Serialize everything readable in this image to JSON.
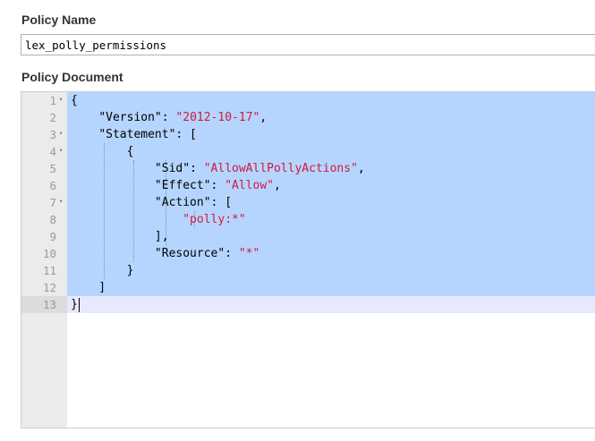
{
  "policy_name": {
    "label": "Policy Name",
    "value": "lex_polly_permissions"
  },
  "policy_document": {
    "label": "Policy Document",
    "lines": [
      {
        "num": "1",
        "fold": true,
        "parts": [
          {
            "t": "p",
            "v": "{"
          }
        ]
      },
      {
        "num": "2",
        "fold": false,
        "parts": [
          {
            "t": "p",
            "v": "    "
          },
          {
            "t": "k",
            "v": "\"Version\""
          },
          {
            "t": "p",
            "v": ": "
          },
          {
            "t": "s",
            "v": "\"2012-10-17\""
          },
          {
            "t": "p",
            "v": ","
          }
        ]
      },
      {
        "num": "3",
        "fold": true,
        "parts": [
          {
            "t": "p",
            "v": "    "
          },
          {
            "t": "k",
            "v": "\"Statement\""
          },
          {
            "t": "p",
            "v": ": ["
          }
        ]
      },
      {
        "num": "4",
        "fold": true,
        "parts": [
          {
            "t": "p",
            "v": "        {"
          }
        ]
      },
      {
        "num": "5",
        "fold": false,
        "parts": [
          {
            "t": "p",
            "v": "            "
          },
          {
            "t": "k",
            "v": "\"Sid\""
          },
          {
            "t": "p",
            "v": ": "
          },
          {
            "t": "s",
            "v": "\"AllowAllPollyActions\""
          },
          {
            "t": "p",
            "v": ","
          }
        ]
      },
      {
        "num": "6",
        "fold": false,
        "parts": [
          {
            "t": "p",
            "v": "            "
          },
          {
            "t": "k",
            "v": "\"Effect\""
          },
          {
            "t": "p",
            "v": ": "
          },
          {
            "t": "s",
            "v": "\"Allow\""
          },
          {
            "t": "p",
            "v": ","
          }
        ]
      },
      {
        "num": "7",
        "fold": true,
        "parts": [
          {
            "t": "p",
            "v": "            "
          },
          {
            "t": "k",
            "v": "\"Action\""
          },
          {
            "t": "p",
            "v": ": ["
          }
        ]
      },
      {
        "num": "8",
        "fold": false,
        "parts": [
          {
            "t": "p",
            "v": "                "
          },
          {
            "t": "s",
            "v": "\"polly:*\""
          }
        ]
      },
      {
        "num": "9",
        "fold": false,
        "parts": [
          {
            "t": "p",
            "v": "            ],"
          }
        ]
      },
      {
        "num": "10",
        "fold": false,
        "parts": [
          {
            "t": "p",
            "v": "            "
          },
          {
            "t": "k",
            "v": "\"Resource\""
          },
          {
            "t": "p",
            "v": ": "
          },
          {
            "t": "s",
            "v": "\"*\""
          }
        ]
      },
      {
        "num": "11",
        "fold": false,
        "parts": [
          {
            "t": "p",
            "v": "        }"
          }
        ]
      },
      {
        "num": "12",
        "fold": false,
        "parts": [
          {
            "t": "p",
            "v": "    ]"
          }
        ]
      },
      {
        "num": "13",
        "fold": false,
        "parts": [
          {
            "t": "p",
            "v": "}"
          }
        ]
      }
    ],
    "active_line": 13,
    "selected_lines": 12
  },
  "colors": {
    "selection": "#b5d5ff",
    "string": "#d01a3c",
    "gutter": "#ebebeb"
  }
}
